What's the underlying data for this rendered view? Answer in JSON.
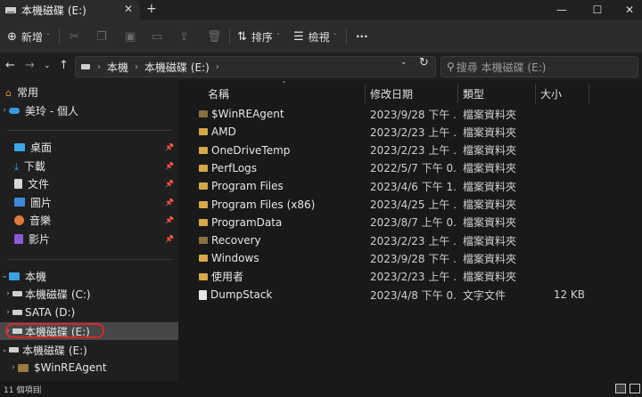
{
  "window": {
    "tab_title": "本機磁碟 (E:)",
    "tab_close": "✕",
    "new_tab": "+",
    "minimize": "—",
    "maximize": "☐",
    "close": "✕"
  },
  "toolbar": {
    "new_label": "新增",
    "sort_label": "排序",
    "view_label": "檢視",
    "more": "···"
  },
  "address": {
    "breadcrumb": [
      "本機",
      "本機磁碟 (E:)"
    ],
    "search_placeholder": "搜尋 本機磁碟 (E:)"
  },
  "sidebar": {
    "home": "常用",
    "cloud": "美玲 - 個人",
    "quick": [
      {
        "label": "桌面",
        "icon": "desktop-icon"
      },
      {
        "label": "下載",
        "icon": "download-icon"
      },
      {
        "label": "文件",
        "icon": "document-icon"
      },
      {
        "label": "圖片",
        "icon": "picture-icon"
      },
      {
        "label": "音樂",
        "icon": "music-icon"
      },
      {
        "label": "影片",
        "icon": "video-icon"
      }
    ],
    "this_pc": "本機",
    "drives": [
      "本機磁碟 (C:)",
      "SATA (D:)",
      "本機磁碟 (E:)"
    ],
    "tree_drive": "本機磁碟 (E:)",
    "tree_child": "$WinREAgent"
  },
  "columns": {
    "name": "名稱",
    "date": "修改日期",
    "type": "類型",
    "size": "大小"
  },
  "files": [
    {
      "name": "$WinREAgent",
      "date": "2023/9/28 下午 ...",
      "type": "檔案資料夾",
      "size": "",
      "kind": "folder-dark"
    },
    {
      "name": "AMD",
      "date": "2023/2/23 上午 ...",
      "type": "檔案資料夾",
      "size": "",
      "kind": "folder"
    },
    {
      "name": "OneDriveTemp",
      "date": "2023/2/23 上午 ...",
      "type": "檔案資料夾",
      "size": "",
      "kind": "folder"
    },
    {
      "name": "PerfLogs",
      "date": "2022/5/7 下午 0...",
      "type": "檔案資料夾",
      "size": "",
      "kind": "folder"
    },
    {
      "name": "Program Files",
      "date": "2023/4/6 下午 1...",
      "type": "檔案資料夾",
      "size": "",
      "kind": "folder"
    },
    {
      "name": "Program Files (x86)",
      "date": "2023/4/25 上午 ...",
      "type": "檔案資料夾",
      "size": "",
      "kind": "folder"
    },
    {
      "name": "ProgramData",
      "date": "2023/8/7 上午 0...",
      "type": "檔案資料夾",
      "size": "",
      "kind": "folder"
    },
    {
      "name": "Recovery",
      "date": "2023/2/23 上午 ...",
      "type": "檔案資料夾",
      "size": "",
      "kind": "folder-dark"
    },
    {
      "name": "Windows",
      "date": "2023/9/28 下午 ...",
      "type": "檔案資料夾",
      "size": "",
      "kind": "folder"
    },
    {
      "name": "使用者",
      "date": "2023/2/23 上午 ...",
      "type": "檔案資料夾",
      "size": "",
      "kind": "folder"
    },
    {
      "name": "DumpStack",
      "date": "2023/4/8 下午 0...",
      "type": "文字文件",
      "size": "12 KB",
      "kind": "file"
    }
  ],
  "status": {
    "count": "11 個項目"
  }
}
